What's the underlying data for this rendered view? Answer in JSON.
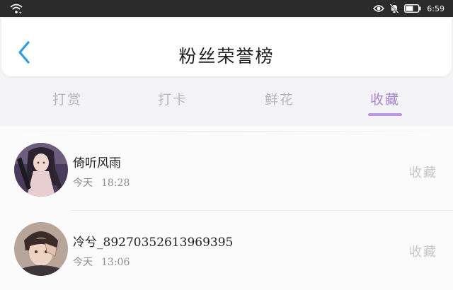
{
  "status_bar": {
    "time": "6:59",
    "battery_level": 0.6
  },
  "header": {
    "title": "粉丝荣誉榜"
  },
  "tabs": [
    {
      "label": "打赏",
      "active": false
    },
    {
      "label": "打卡",
      "active": false
    },
    {
      "label": "鲜花",
      "active": false
    },
    {
      "label": "收藏",
      "active": true
    }
  ],
  "records": [
    {
      "nickname": "倚听风雨",
      "day": "今天",
      "time": "18:28",
      "action": "收藏"
    },
    {
      "nickname": "冷兮_89270352613969395",
      "day": "今天",
      "time": "13:06",
      "action": "收藏"
    }
  ],
  "colors": {
    "accent": "#a982d0",
    "underline": "#b89ae0",
    "back_arrow": "#2f9be0",
    "status_bar": "#2b2b2b"
  }
}
